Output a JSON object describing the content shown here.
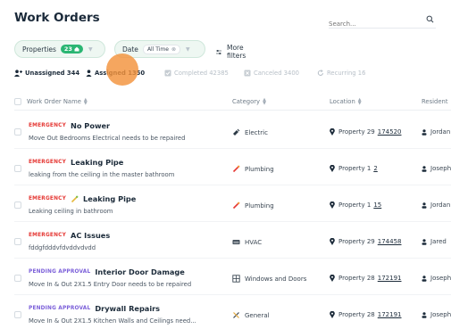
{
  "header": {
    "title": "Work Orders",
    "search_placeholder": "Search..."
  },
  "filters": {
    "properties_label": "Properties",
    "properties_count": "23",
    "date_label": "Date",
    "date_value": "All Time",
    "more_filters": "More filters"
  },
  "tabs": [
    {
      "label": "Unassigned 344",
      "active": false
    },
    {
      "label": "Assigned 1350",
      "active": true
    },
    {
      "label": "Completed 42385",
      "active": false
    },
    {
      "label": "Canceled 3400",
      "active": false
    },
    {
      "label": "Recurring 16",
      "active": false
    }
  ],
  "table": {
    "columns": [
      "Work Order Name",
      "Category",
      "Location",
      "Resident"
    ],
    "rows": [
      {
        "status": "EMERGENCY",
        "name": "No Power",
        "description": "Move Out Bedrooms Electrical needs to be repaired",
        "category": "Electric",
        "category_icon": "electric-icon",
        "property": "Property 29",
        "unit": "174520",
        "resident": "Jordan"
      },
      {
        "status": "EMERGENCY",
        "name": "Leaking Pipe",
        "description": "leaking from the ceiling in the master bathroom",
        "category": "Plumbing",
        "category_icon": "plumbing-icon",
        "property": "Property 1",
        "unit": "2",
        "resident": "Joseph"
      },
      {
        "status": "EMERGENCY",
        "name": "Leaking Pipe",
        "description": "Leaking ceiling in bathroom",
        "category": "Plumbing",
        "category_icon": "plumbing-icon",
        "property": "Property 1",
        "unit": "15",
        "resident": "Jordan"
      },
      {
        "status": "EMERGENCY",
        "name": "AC Issues",
        "description": "fddgfdddvfdvddvdvdd",
        "category": "HVAC",
        "category_icon": "hvac-icon",
        "property": "Property 29",
        "unit": "174458",
        "resident": "Jared"
      },
      {
        "status": "PENDING APPROVAL",
        "name": "Interior Door Damage",
        "description": "Move In & Out 2X1.5 Entry Door needs to be repaired",
        "category": "Windows and Doors",
        "category_icon": "window-icon",
        "property": "Property 28",
        "unit": "172191",
        "resident": "Joseph"
      },
      {
        "status": "PENDING APPROVAL",
        "name": "Drywall Repairs",
        "description": "Move In & Out 2X1.5 Kitchen Walls and Ceilings need...",
        "category": "General",
        "category_icon": "tools-icon",
        "property": "Property 28",
        "unit": "172191",
        "resident": "Joseph"
      }
    ]
  },
  "colors": {
    "accent_green": "#2bb673",
    "emergency": "#e53935",
    "pending": "#7b5fd9",
    "click_marker": "#f3923c"
  }
}
